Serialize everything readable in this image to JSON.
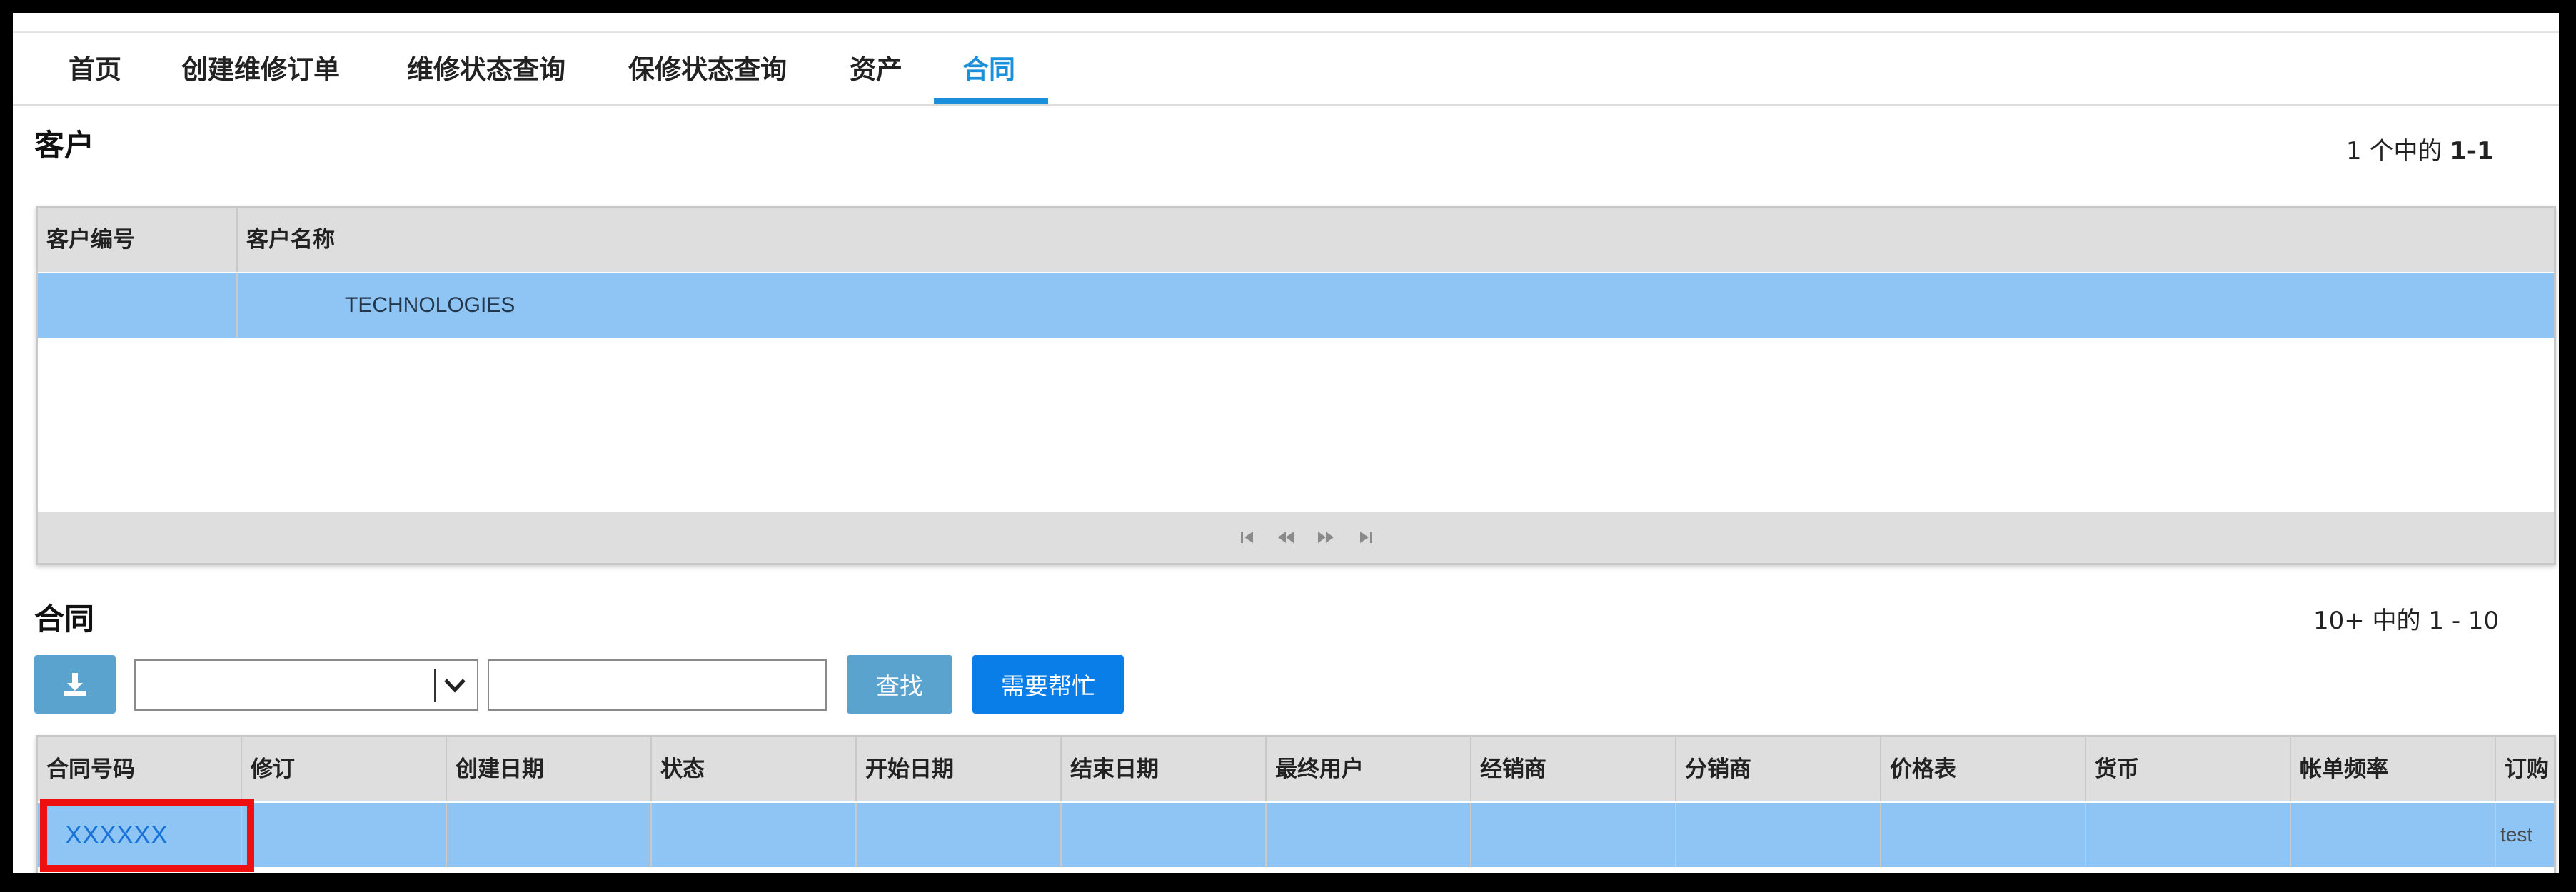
{
  "nav": {
    "tabs": [
      {
        "label": "首页",
        "active": false
      },
      {
        "label": "创建维修订单",
        "active": false
      },
      {
        "label": "维修状态查询",
        "active": false
      },
      {
        "label": "保修状态查询",
        "active": false
      },
      {
        "label": "资产",
        "active": false
      },
      {
        "label": "合同",
        "active": true
      }
    ],
    "accent_color": "#1a8fdc"
  },
  "customer_section": {
    "title": "客户",
    "pager": {
      "prefix": "1 个中的",
      "range": "1-1"
    },
    "columns": [
      "客户编号",
      "客户名称"
    ],
    "rows": [
      {
        "id": "",
        "name": "TECHNOLOGIES",
        "selected": true
      }
    ],
    "footer_icons": [
      "first-page-icon",
      "prev-page-icon",
      "next-page-icon",
      "last-page-icon"
    ]
  },
  "contract_section": {
    "title": "合同",
    "pager": {
      "prefix": "10+ 中的",
      "range": "1 - 10"
    },
    "toolbar": {
      "download_icon": "download-icon",
      "select_value": "",
      "search_value": "",
      "find_label": "查找",
      "help_label": "需要帮忙"
    },
    "columns": [
      "合同号码",
      "修订",
      "创建日期",
      "状态",
      "开始日期",
      "结束日期",
      "最终用户",
      "经销商",
      "分销商",
      "价格表",
      "货币",
      "帐单频率",
      "订购"
    ],
    "rows": [
      {
        "contract_no": "XXXXXX",
        "last_cell": "test",
        "selected": true
      }
    ]
  },
  "colors": {
    "selected_row": "#8ec5f5",
    "header_bg": "#dedede",
    "primary_button": "#0a7ee8",
    "secondary_button": "#5ba3cf",
    "highlight": "#ee1010"
  }
}
